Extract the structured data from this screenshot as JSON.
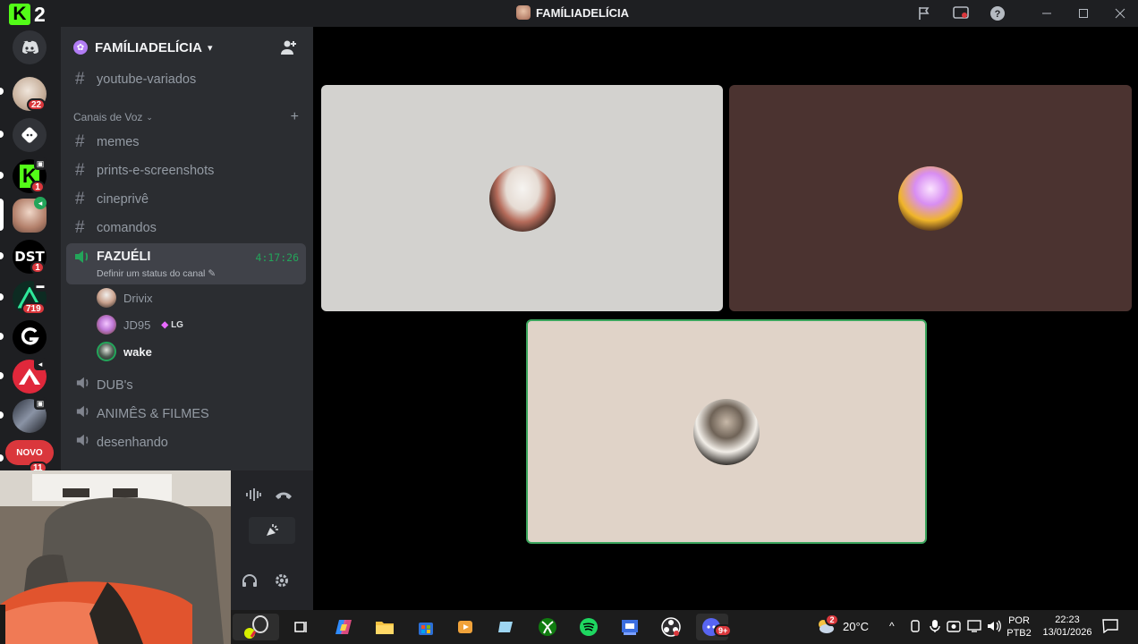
{
  "app": {
    "launcher_badge": "2",
    "window_title": "FAMÍLIADELÍCIA"
  },
  "server_rail": {
    "badges": [
      "22",
      "1",
      "1",
      "719",
      "11"
    ],
    "new_label": "NOVO"
  },
  "guild": {
    "name": "FAMÍLIADELÍCIA"
  },
  "channels": {
    "top": [
      {
        "name": "youtube-variados"
      }
    ],
    "category": "Canais de Voz",
    "text": [
      {
        "name": "memes"
      },
      {
        "name": "prints-e-screenshots"
      },
      {
        "name": "cineprivê"
      },
      {
        "name": "comandos"
      }
    ],
    "active_voice": {
      "name": "FAZUÉLI",
      "timer": "4:17:26",
      "status": "Definir um status do canal"
    },
    "members": [
      {
        "name": "Drivix"
      },
      {
        "name": "JD95",
        "tag": "LG"
      },
      {
        "name": "wake"
      }
    ],
    "voice": [
      {
        "name": "DUB's"
      },
      {
        "name": "ANIMÊS & FILMES"
      },
      {
        "name": "desenhando"
      }
    ]
  },
  "taskbar": {
    "weather_badge": "2",
    "temperature": "20°C",
    "language": "POR",
    "keyboard": "PTB2",
    "time": "22:23",
    "date": "13/01/2026",
    "discord_badge": "9+"
  },
  "colors": {
    "accent_green": "#23a55a",
    "speaking_border": "#3ba55d",
    "tile1_bg": "#d3d2cf",
    "tile2_bg": "#4b3330",
    "tile3_bg": "#e0d3c8",
    "badge_red": "#da373c"
  }
}
